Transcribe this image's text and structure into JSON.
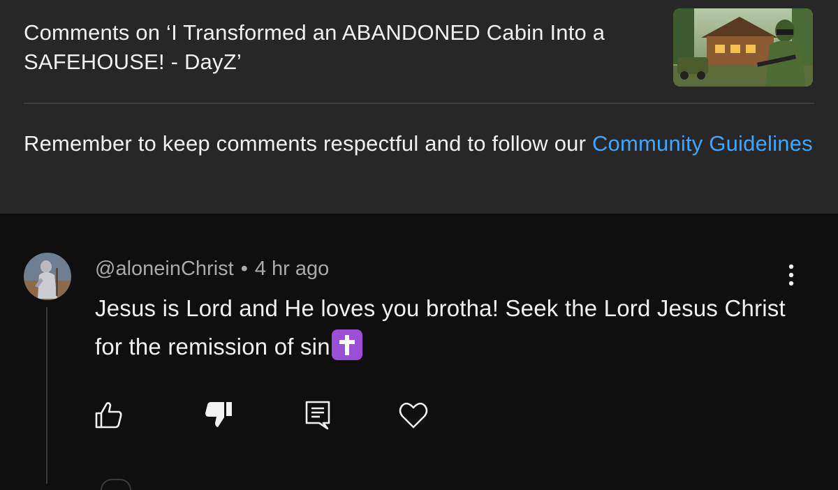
{
  "header": {
    "title": "Comments on ‘I Transformed an ABANDONED Cabin Into a SAFEHOUSE! - DayZ’",
    "thumbnail_icon": "video-thumbnail",
    "notice_text": "Remember to keep comments respectful and to follow our ",
    "notice_link": "Community Guidelines"
  },
  "comment": {
    "author": "@aloneinChrist",
    "separator": "•",
    "time": "4 hr ago",
    "text": "Jesus is Lord and He loves you brotha! Seek the Lord Jesus Christ for the remission of sin",
    "emoji": "latin-cross-emoji",
    "actions": [
      "like-icon",
      "dislike-icon",
      "reply-icon",
      "heart-icon"
    ],
    "menu_icon": "more-vertical-icon"
  },
  "colors": {
    "header_bg": "#272727",
    "page_bg": "#0f0f0f",
    "link": "#3ea6ff",
    "text": "#f1f1f1",
    "muted": "#aaaaaa"
  }
}
